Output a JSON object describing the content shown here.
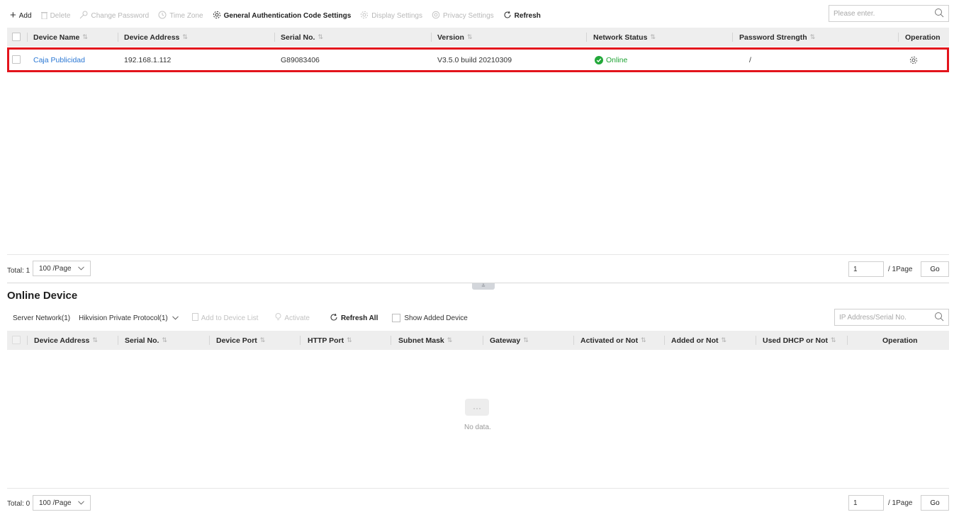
{
  "toolbar": {
    "add": "Add",
    "delete": "Delete",
    "change_password": "Change Password",
    "time_zone": "Time Zone",
    "general_auth": "General Authentication Code Settings",
    "display_settings": "Display Settings",
    "privacy_settings": "Privacy Settings",
    "refresh": "Refresh"
  },
  "search": {
    "placeholder": "Please enter."
  },
  "device_table": {
    "columns": [
      "Device Name",
      "Device Address",
      "Serial No.",
      "Version",
      "Network Status",
      "Password Strength",
      "Operation"
    ],
    "rows": [
      {
        "device_name": "Caja Publicidad",
        "device_address": "192.168.1.112",
        "serial_no": "G89083406",
        "version": "V3.5.0 build 20210309",
        "network_status": "Online",
        "password_strength": "/"
      }
    ]
  },
  "pagination_top": {
    "total_label": "Total: 1",
    "per_page": "100 /Page",
    "page": "1",
    "page_suffix": "/ 1Page",
    "go": "Go"
  },
  "online_device": {
    "title": "Online Device",
    "server_network": "Server Network(1)",
    "protocol": "Hikvision Private Protocol(1)",
    "add_to_list": "Add to Device List",
    "activate": "Activate",
    "refresh_all": "Refresh All",
    "show_added": "Show Added Device",
    "search_placeholder": "IP Address/Serial No.",
    "columns": [
      "Device Address",
      "Serial No.",
      "Device Port",
      "HTTP Port",
      "Subnet Mask",
      "Gateway",
      "Activated or Not",
      "Added or Not",
      "Used DHCP or Not",
      "Operation"
    ],
    "empty_text": "No data."
  },
  "pagination_bottom": {
    "total_label": "Total: 0",
    "per_page": "100 /Page",
    "page": "1",
    "page_suffix": "/ 1Page",
    "go": "Go"
  },
  "colors": {
    "link": "#2b78d4",
    "online": "#1fa335",
    "highlight": "#e3141c",
    "header_bg": "#eeeeee"
  },
  "icons": {
    "add": "plus-icon",
    "delete": "trash-icon",
    "change_password": "key-icon",
    "time_zone": "clock-icon",
    "general_auth": "gear-icon",
    "display_settings": "gear-icon",
    "privacy_settings": "shield-icon",
    "refresh": "refresh-icon",
    "search": "search-icon",
    "operation": "gear-icon",
    "status": "check-circle-icon"
  }
}
